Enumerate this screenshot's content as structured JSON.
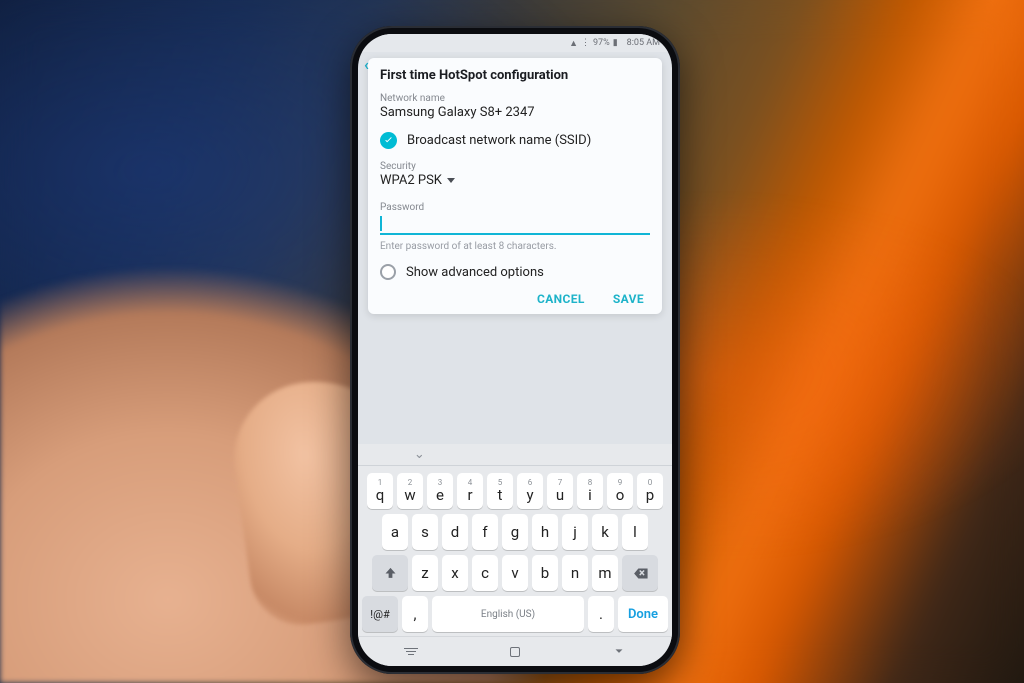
{
  "statusbar": {
    "battery": "97%",
    "time": "8:05 AM"
  },
  "dialog": {
    "title": "First time HotSpot configuration",
    "network_name_label": "Network name",
    "network_name_value": "Samsung Galaxy S8+ 2347",
    "broadcast_label": "Broadcast network name (SSID)",
    "broadcast_checked": true,
    "security_label": "Security",
    "security_value": "WPA2 PSK",
    "password_label": "Password",
    "password_value": "",
    "password_hint": "Enter password of at least 8 characters.",
    "advanced_label": "Show advanced options",
    "advanced_checked": false,
    "cancel_label": "CANCEL",
    "save_label": "SAVE"
  },
  "keyboard": {
    "row1": [
      {
        "d": "1",
        "l": "q"
      },
      {
        "d": "2",
        "l": "w"
      },
      {
        "d": "3",
        "l": "e"
      },
      {
        "d": "4",
        "l": "r"
      },
      {
        "d": "5",
        "l": "t"
      },
      {
        "d": "6",
        "l": "y"
      },
      {
        "d": "7",
        "l": "u"
      },
      {
        "d": "8",
        "l": "i"
      },
      {
        "d": "9",
        "l": "o"
      },
      {
        "d": "0",
        "l": "p"
      }
    ],
    "row2": [
      "a",
      "s",
      "d",
      "f",
      "g",
      "h",
      "j",
      "k",
      "l"
    ],
    "row3": [
      "z",
      "x",
      "c",
      "v",
      "b",
      "n",
      "m"
    ],
    "sym_label": "!@#",
    "space_label": "English (US)",
    "done_label": "Done",
    "comma": ",",
    "period": "."
  }
}
